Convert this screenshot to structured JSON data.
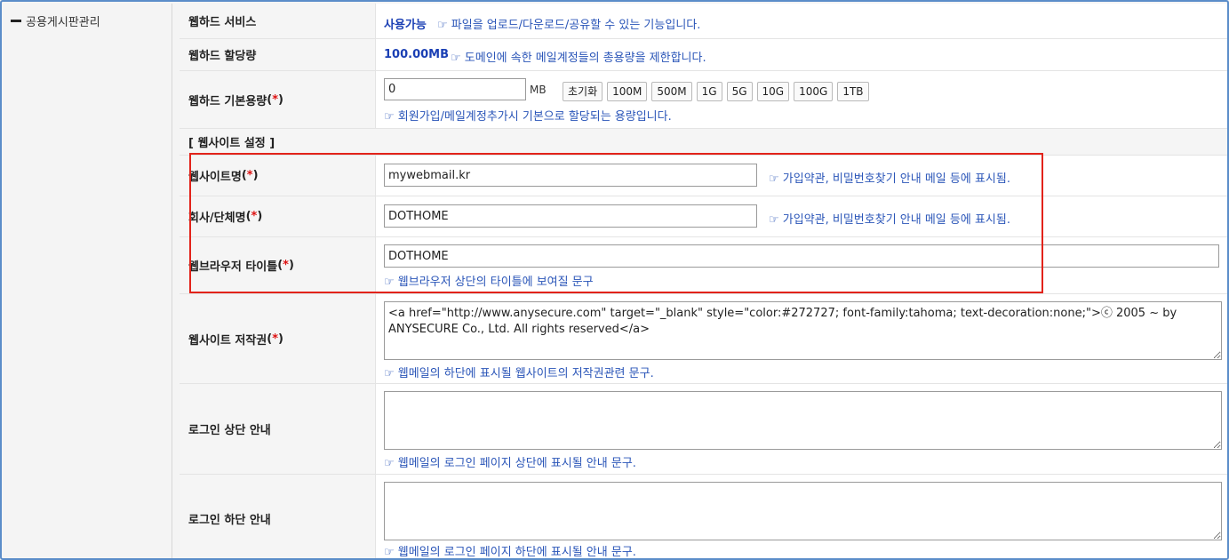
{
  "sidebar": {
    "items": [
      {
        "label": "공용게시판관리"
      }
    ]
  },
  "webhard_service": {
    "label": "웹하드 서비스",
    "status": "사용가능",
    "hint": "☞ 파일을 업로드/다운로드/공유할 수 있는 기능입니다."
  },
  "webhard_quota": {
    "label": "웹하드 할당량",
    "value": "100.00MB",
    "hint": "☞ 도메인에 속한 메일계정들의 총용량을 제한합니다."
  },
  "webhard_default": {
    "label": "웹하드 기본용량",
    "required": "*",
    "value": "0",
    "unit": "MB",
    "buttons": [
      "초기화",
      "100M",
      "500M",
      "1G",
      "5G",
      "10G",
      "100G",
      "1TB"
    ],
    "hint": "☞ 회원가입/메일계정추가시 기본으로 할당되는 용량입니다."
  },
  "section_title": "[ 웹사이트 설정 ]",
  "site_name": {
    "label": "웹사이트명",
    "required": "*",
    "value": "mywebmail.kr",
    "hint": "☞ 가입약관, 비밀번호찾기 안내 메일 등에 표시됨."
  },
  "company_name": {
    "label": "회사/단체명",
    "required": "*",
    "value": "DOTHOME",
    "hint": "☞ 가입약관, 비밀번호찾기 안내 메일 등에 표시됨."
  },
  "browser_title": {
    "label": "웹브라우저 타이틀",
    "required": "*",
    "value": "DOTHOME",
    "hint": "☞ 웹브라우저 상단의 타이틀에 보여질 문구"
  },
  "copyright": {
    "label": "웹사이트 저작권",
    "required": "*",
    "value": "<a href=\"http://www.anysecure.com\" target=\"_blank\" style=\"color:#272727; font-family:tahoma; text-decoration:none;\">ⓒ 2005 ~ by ANYSECURE Co., Ltd. All rights reserved</a>",
    "hint": "☞ 웹메일의 하단에 표시될 웹사이트의 저작권관련 문구."
  },
  "login_top": {
    "label": "로그인 상단 안내",
    "value": "",
    "hint": "☞ 웹메일의 로그인 페이지 상단에 표시될 안내 문구."
  },
  "login_bottom": {
    "label": "로그인 하단 안내",
    "value": "",
    "hint": "☞ 웹메일의 로그인 페이지 하단에 표시될 안내 문구."
  },
  "colors": {
    "accent_blue": "#1a3fb4",
    "hint_blue": "#2a55b8",
    "required_red": "#dd1111",
    "highlight_red": "#e2231a"
  }
}
